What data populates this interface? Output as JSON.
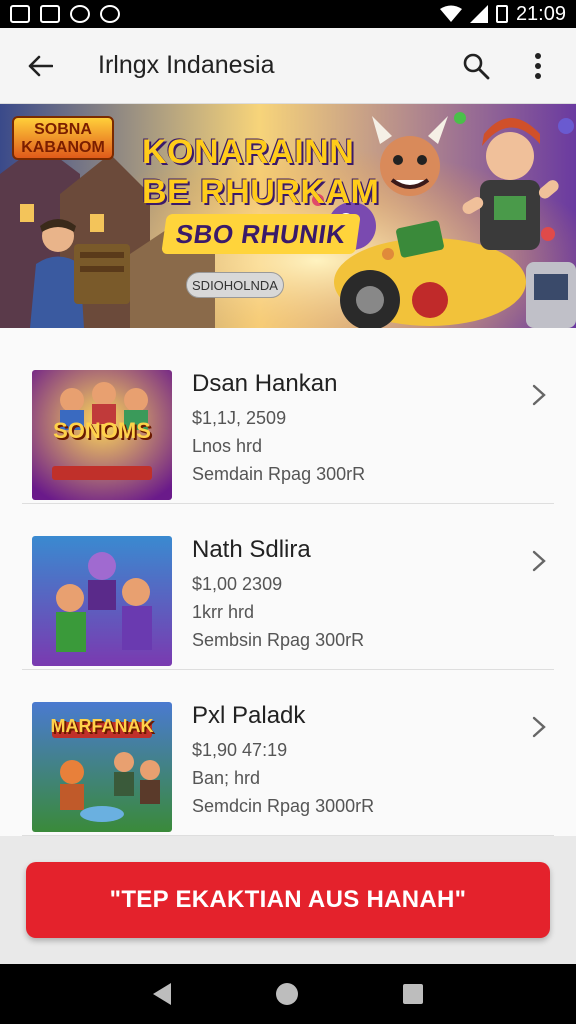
{
  "status_bar": {
    "time": "21:09"
  },
  "app_bar": {
    "title": "Irlngx Indanesia"
  },
  "banner": {
    "logo_text": "SOBNA KABANOM",
    "headline_line1": "KONARAINN",
    "headline_line2": "BE RHURKAM",
    "headline_line3": "SBO RHUNIK",
    "pill_label": "SDIOHOLNDA"
  },
  "games": [
    {
      "name": "Dsan Hankan",
      "price": "$1,1J, 2509",
      "meta": "Lnos hrd",
      "note": "Semdain Rpag 300rR",
      "thumb_title": "SONOMS"
    },
    {
      "name": "Nath Sdlira",
      "price": "$1,00 2309",
      "meta": "1krr hrd",
      "note": "Sembsin Rpag 300rR",
      "thumb_title": ""
    },
    {
      "name": "Pxl Paladk",
      "price": "$1,90 47:19",
      "meta": "Ban; hrd",
      "note": "Semdcin Rpag 3000rR",
      "thumb_title": "MARFANAK"
    }
  ],
  "cta": {
    "label": "\"TEP EKAKTIAN AUS HANAH\""
  },
  "colors": {
    "accent": "#e4222c",
    "banner_title": "#ffcc1a"
  }
}
